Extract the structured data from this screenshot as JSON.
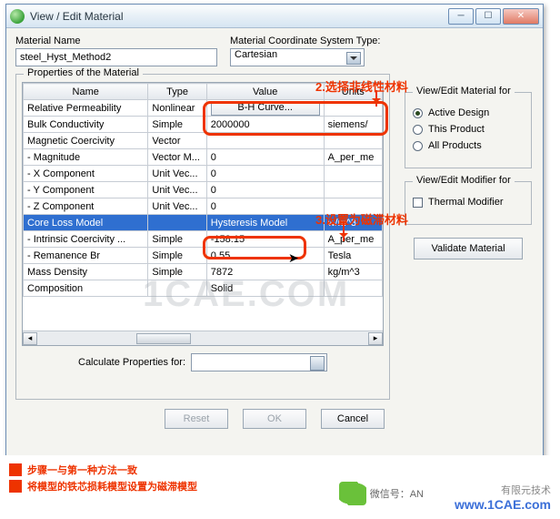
{
  "titlebar": {
    "title": "View / Edit Material"
  },
  "top": {
    "mat_name_label": "Material Name",
    "mat_name_value": "steel_Hyst_Method2",
    "coord_label": "Material Coordinate System Type:",
    "coord_value": "Cartesian"
  },
  "annot": {
    "a1": "2.选择非线性材料",
    "a2": "3.设置为磁滞材料"
  },
  "props": {
    "group_title": "Properties of the Material",
    "headers": {
      "name": "Name",
      "type": "Type",
      "value": "Value",
      "units": "Units"
    },
    "rows": [
      {
        "n": "Relative Permeability",
        "t": "Nonlinear",
        "v": "B-H Curve...",
        "u": "",
        "bh": true
      },
      {
        "n": "Bulk Conductivity",
        "t": "Simple",
        "v": "2000000",
        "u": "siemens/"
      },
      {
        "n": "Magnetic Coercivity",
        "t": "Vector",
        "v": "",
        "u": ""
      },
      {
        "n": "- Magnitude",
        "t": "Vector M...",
        "v": "0",
        "u": "A_per_me"
      },
      {
        "n": "- X Component",
        "t": "Unit Vec...",
        "v": "0",
        "u": ""
      },
      {
        "n": "- Y Component",
        "t": "Unit Vec...",
        "v": "0",
        "u": ""
      },
      {
        "n": "- Z Component",
        "t": "Unit Vec...",
        "v": "0",
        "u": ""
      },
      {
        "n": "Core Loss Model",
        "t": "",
        "v": "Hysteresis Model",
        "u": "w/m^3",
        "sel": true
      },
      {
        "n": "- Intrinsic Coercivity ...",
        "t": "Simple",
        "v": "-158.15",
        "u": "A_per_me"
      },
      {
        "n": "- Remanence Br",
        "t": "Simple",
        "v": "0.55",
        "u": "Tesla"
      },
      {
        "n": "Mass Density",
        "t": "Simple",
        "v": "7872",
        "u": "kg/m^3"
      },
      {
        "n": "Composition",
        "t": "",
        "v": "Solid",
        "u": ""
      }
    ],
    "calc_label": "Calculate Properties for:",
    "reset": "Reset",
    "ok": "OK",
    "cancel": "Cancel"
  },
  "right": {
    "g1_title": "View/Edit Material for",
    "r1": "Active Design",
    "r2": "This Product",
    "r3": "All Products",
    "g2_title": "View/Edit Modifier for",
    "c1": "Thermal Modifier",
    "validate": "Validate Material"
  },
  "footer": {
    "b1": "步骤一与第一种方法一致",
    "b2": "将模型的铁芯损耗模型设置为磁滞模型",
    "wx": "微信号：AN",
    "sig": "有限元技术",
    "site": "www.1CAE.com"
  },
  "wm": "1CAE.COM"
}
